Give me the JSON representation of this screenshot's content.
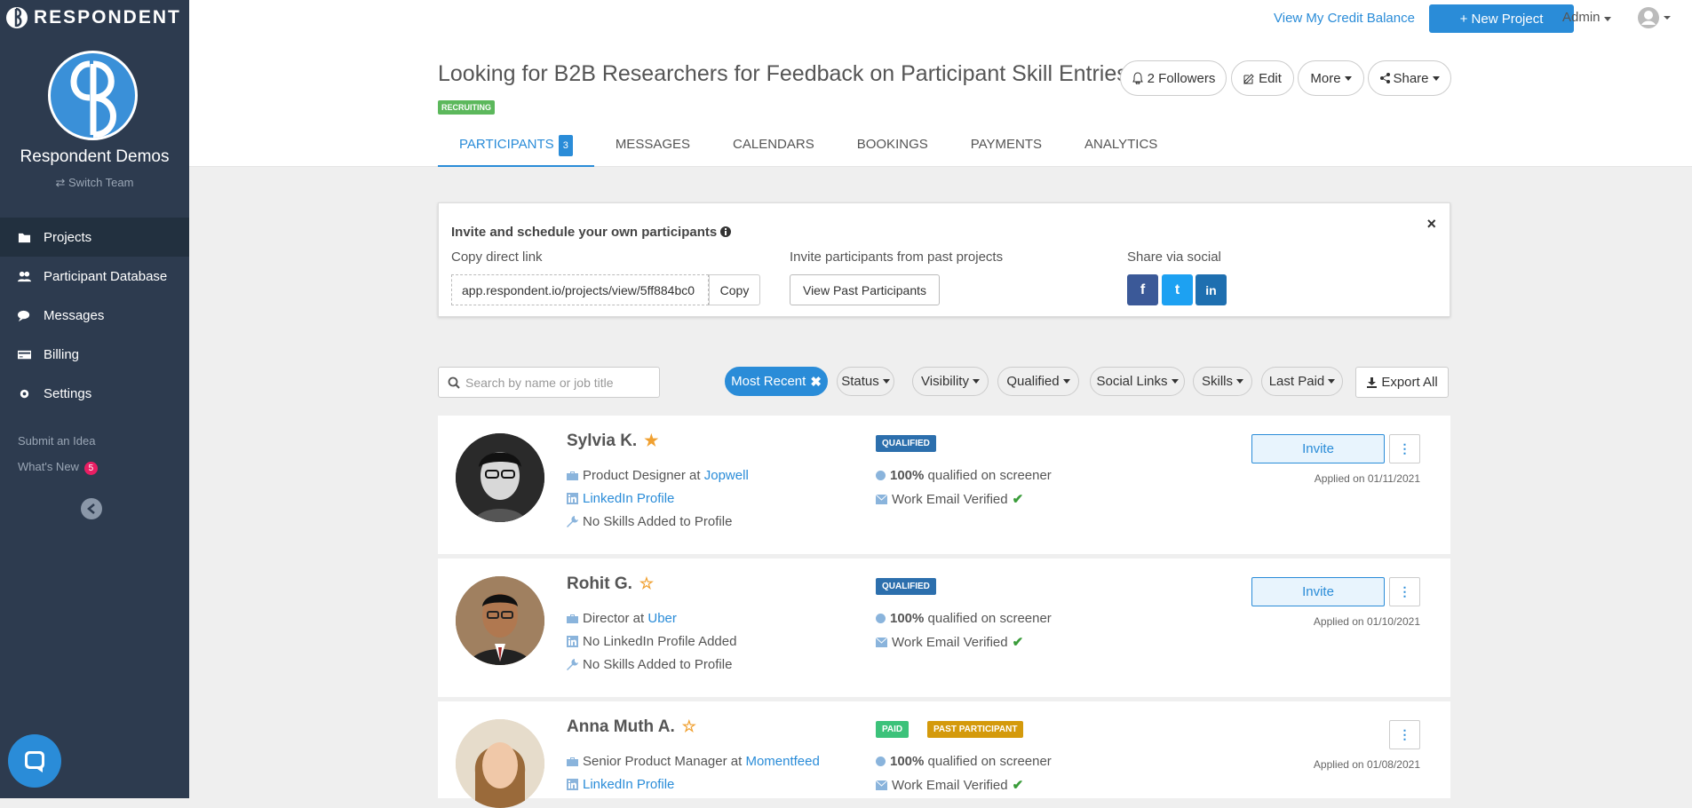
{
  "app": {
    "brand": "RESPONDENT",
    "team_name": "Respondent Demos",
    "switch_team": "Switch Team"
  },
  "sidebar": {
    "items": [
      {
        "label": "Projects",
        "icon": "folder-icon",
        "active": true
      },
      {
        "label": "Participant Database",
        "icon": "users-icon"
      },
      {
        "label": "Messages",
        "icon": "comments-icon"
      },
      {
        "label": "Billing",
        "icon": "credit-card-icon"
      },
      {
        "label": "Settings",
        "icon": "gear-icon"
      }
    ],
    "submit_idea": "Submit an Idea",
    "whats_new": "What's New",
    "whats_new_count": "5"
  },
  "topbar": {
    "credit_link": "View My Credit Balance",
    "new_project": "+ New Project",
    "admin": "Admin"
  },
  "project": {
    "title": "Looking for B2B Researchers for Feedback on Participant Skill Entries",
    "status": "RECRUITING",
    "followers": "2 Followers",
    "edit": "Edit",
    "more": "More",
    "share": "Share"
  },
  "tabs": [
    {
      "label": "PARTICIPANTS",
      "count": "3",
      "active": true
    },
    {
      "label": "MESSAGES"
    },
    {
      "label": "CALENDARS"
    },
    {
      "label": "BOOKINGS"
    },
    {
      "label": "PAYMENTS"
    },
    {
      "label": "ANALYTICS"
    }
  ],
  "invite": {
    "title": "Invite and schedule your own participants",
    "copy_label": "Copy direct link",
    "link_value": "app.respondent.io/projects/view/5ff884bc0",
    "copy_btn": "Copy",
    "past_label": "Invite participants from past projects",
    "past_btn": "View Past Participants",
    "social_label": "Share via social",
    "close": "×",
    "social": [
      {
        "name": "facebook",
        "glyph": "f",
        "color": "#3b5998"
      },
      {
        "name": "twitter",
        "glyph": "t",
        "color": "#1da1f2"
      },
      {
        "name": "linkedin",
        "glyph": "in",
        "color": "#1e6fb0"
      }
    ]
  },
  "filters": {
    "search_placeholder": "Search by name or job title",
    "sort": "Most Recent",
    "items": [
      "Status",
      "Visibility",
      "Qualified",
      "Social Links",
      "Skills",
      "Last Paid"
    ],
    "export": "Export All"
  },
  "participants": [
    {
      "name": "Sylvia K.",
      "starred": true,
      "role": "Product Designer at ",
      "company": "Jopwell",
      "linkedin": "LinkedIn Profile",
      "linkedin_is_link": true,
      "skills": "No Skills Added to Profile",
      "badges": [
        {
          "text": "QUALIFIED",
          "color": "#2c6fad"
        }
      ],
      "qualified_pct": "100%",
      "qualified_text": "qualified on screener",
      "email": "Work Email Verified",
      "invite": "Invite",
      "applied": "Applied on 01/11/2021"
    },
    {
      "name": "Rohit G.",
      "starred": false,
      "role": "Director at ",
      "company": "Uber",
      "linkedin": "No LinkedIn Profile Added",
      "linkedin_is_link": false,
      "skills": "No Skills Added to Profile",
      "badges": [
        {
          "text": "QUALIFIED",
          "color": "#2c6fad"
        }
      ],
      "qualified_pct": "100%",
      "qualified_text": "qualified on screener",
      "email": "Work Email Verified",
      "invite": "Invite",
      "applied": "Applied on 01/10/2021"
    },
    {
      "name": "Anna Muth A.",
      "starred": false,
      "role": "Senior Product Manager at ",
      "company": "Momentfeed",
      "linkedin": "LinkedIn Profile",
      "linkedin_is_link": true,
      "skills": "",
      "badges": [
        {
          "text": "PAID",
          "color": "#3cc27a"
        },
        {
          "text": "PAST PARTICIPANT",
          "color": "#d49a0c"
        }
      ],
      "qualified_pct": "100%",
      "qualified_text": "qualified on screener",
      "email": "Work Email Verified",
      "invite": "",
      "applied": "Applied on 01/08/2021"
    }
  ]
}
